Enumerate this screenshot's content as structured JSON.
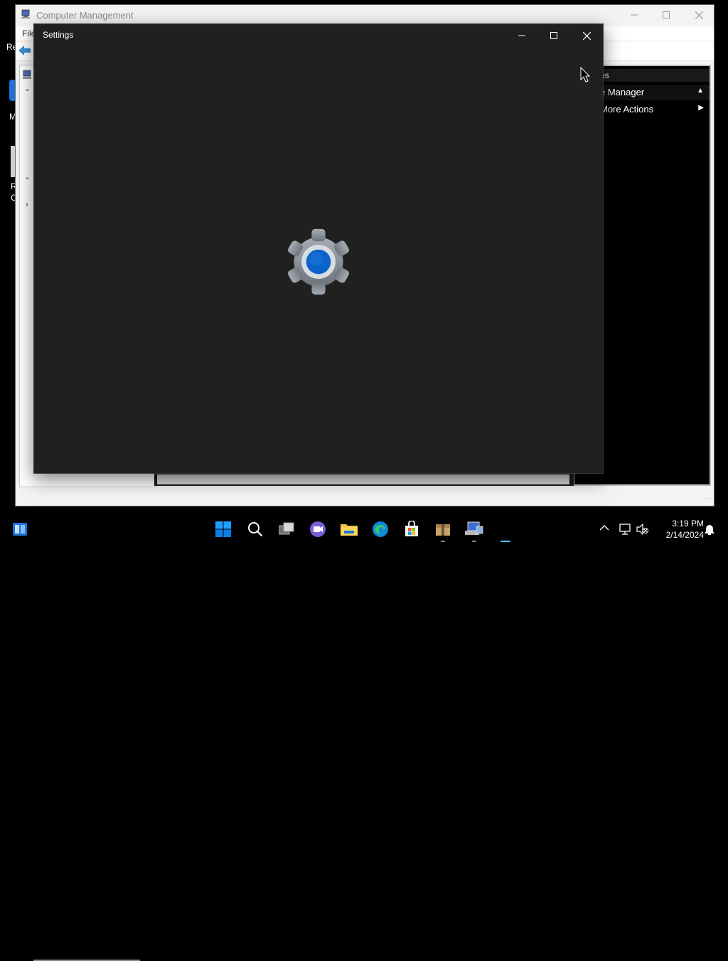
{
  "desktop": {
    "frag1": "Re",
    "frag2": "M",
    "frag3": "R",
    "frag4": "C"
  },
  "computer_management": {
    "title": "Computer Management",
    "menu_file": "File",
    "actions": {
      "header": "ns",
      "row1": "e Manager",
      "row2": "More Actions"
    }
  },
  "settings": {
    "title": "Settings"
  },
  "taskbar": {
    "time": "3:19 PM",
    "date": "2/14/2024",
    "pinned": [
      "widgets-icon",
      "start-icon",
      "search-icon",
      "task-view-icon",
      "chat-icon",
      "file-explorer-icon",
      "edge-icon",
      "store-icon",
      "package-icon",
      "computer-management-icon"
    ]
  },
  "colors": {
    "settings_bg": "#202020",
    "accent_blue": "#0a63c9",
    "taskbar_bg": "#000000"
  }
}
